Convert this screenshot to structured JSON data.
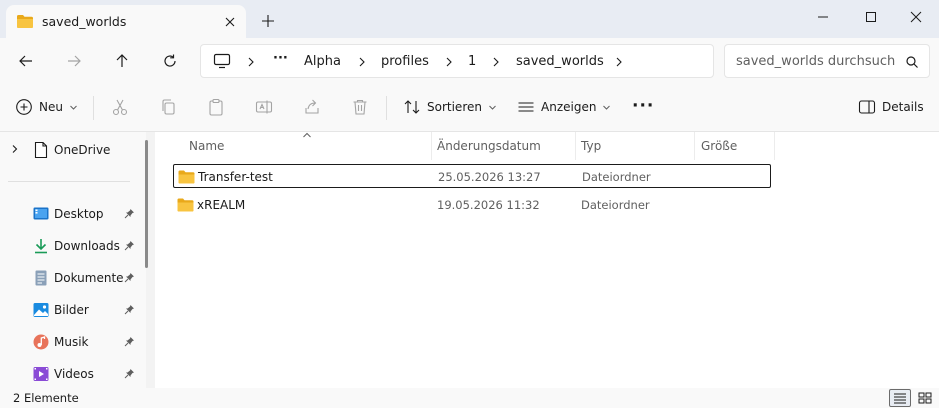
{
  "window": {
    "tab_title": "saved_worlds",
    "colors": {
      "accent": "#0067c0",
      "folder": "#f8c440",
      "titlebar": "#e8ecf3"
    }
  },
  "address": {
    "breadcrumbs": [
      "Alpha",
      "profiles",
      "1",
      "saved_worlds"
    ],
    "ellipsis": "···"
  },
  "search": {
    "placeholder": "saved_worlds durchsuch"
  },
  "commands": {
    "new": "Neu",
    "sort": "Sortieren",
    "view": "Anzeigen",
    "more": "···",
    "details": "Details"
  },
  "sidebar": {
    "onedrive": "OneDrive",
    "items": [
      {
        "label": "Desktop",
        "icon": "desktop-icon"
      },
      {
        "label": "Downloads",
        "icon": "downloads-icon"
      },
      {
        "label": "Dokumente",
        "icon": "documents-icon"
      },
      {
        "label": "Bilder",
        "icon": "pictures-icon"
      },
      {
        "label": "Musik",
        "icon": "music-icon"
      },
      {
        "label": "Videos",
        "icon": "videos-icon"
      }
    ]
  },
  "columns": [
    "Name",
    "Änderungsdatum",
    "Typ",
    "Größe"
  ],
  "files": [
    {
      "name": "Transfer-test",
      "date": "25.05.2026 13:27",
      "type": "Dateiordner",
      "selected": true
    },
    {
      "name": "xREALM",
      "date": "19.05.2026 11:32",
      "type": "Dateiordner",
      "selected": false
    }
  ],
  "status": {
    "count": "2 Elemente"
  }
}
